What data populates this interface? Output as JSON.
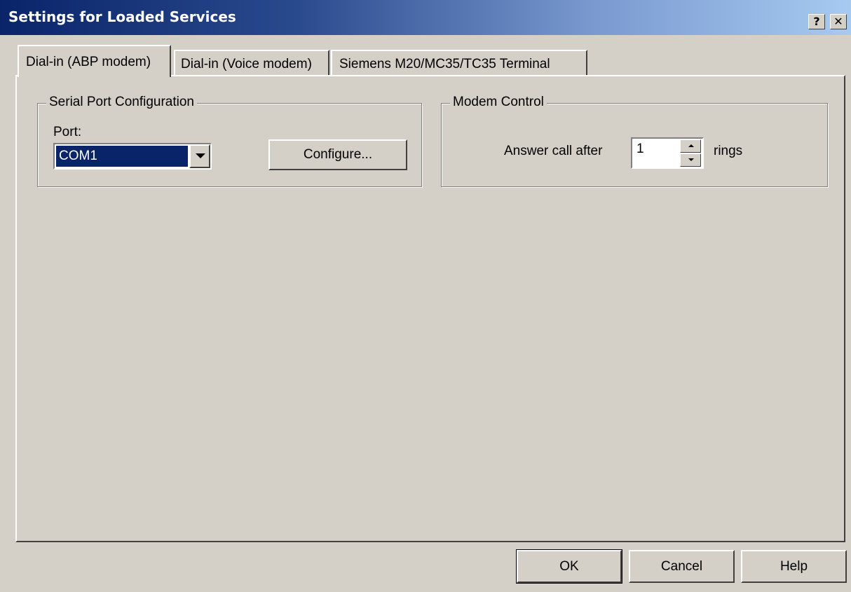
{
  "window": {
    "title": "Settings for Loaded Services",
    "help_glyph": "?",
    "close_glyph": "✕"
  },
  "tabs": [
    {
      "label": "Dial-in (ABP modem)",
      "selected": true
    },
    {
      "label": "Dial-in (Voice modem)",
      "selected": false
    },
    {
      "label": "Siemens M20/MC35/TC35 Terminal",
      "selected": false
    }
  ],
  "serial_port": {
    "group_label": "Serial Port Configuration",
    "port_label": "Port:",
    "port_value": "COM1",
    "configure_label": "Configure..."
  },
  "modem_control": {
    "group_label": "Modem Control",
    "answer_label": "Answer call after",
    "rings_value": "1",
    "rings_label": "rings"
  },
  "footer": {
    "ok_label": "OK",
    "cancel_label": "Cancel",
    "help_label": "Help"
  },
  "colors": {
    "title_start": "#0a246a",
    "title_end": "#a6caf0",
    "face": "#d4d0c8",
    "selection": "#0a246a"
  }
}
